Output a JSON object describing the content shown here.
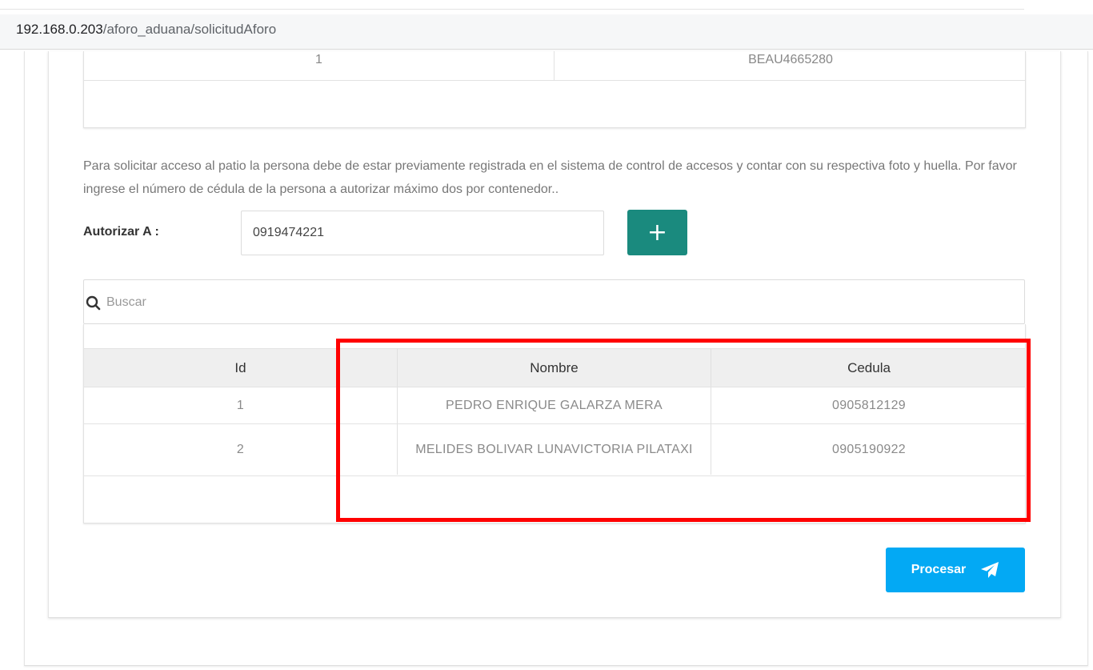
{
  "browser": {
    "url_host": "192.168.0.203",
    "url_path": "/aforo_aduana/solicitudAforo"
  },
  "container_table": {
    "rows": [
      {
        "num": "1",
        "container": "BEAU4665280"
      }
    ]
  },
  "info_text": "Para solicitar acceso al patio la persona debe de estar previamente registrada en el sistema de control de accesos y contar con su respectiva foto y huella.  Por favor ingrese el número de cédula de la persona a autorizar máximo dos por contenedor..",
  "authorize": {
    "label": "Autorizar A :",
    "value": "0919474221",
    "add_symbol": "+"
  },
  "search": {
    "placeholder": "Buscar"
  },
  "people_table": {
    "headers": {
      "id": "Id",
      "nombre": "Nombre",
      "cedula": "Cedula"
    },
    "rows": [
      {
        "id": "1",
        "nombre": "PEDRO ENRIQUE GALARZA MERA",
        "cedula": "0905812129"
      },
      {
        "id": "2",
        "nombre": "MELIDES BOLIVAR LUNAVICTORIA PILATAXI",
        "cedula": "0905190922"
      }
    ]
  },
  "process_button": {
    "label": "Procesar",
    "icon": "paper-plane-icon"
  },
  "colors": {
    "add_button": "#1a8a7e",
    "process_button": "#03a9f4",
    "highlight": "#ff0000"
  }
}
